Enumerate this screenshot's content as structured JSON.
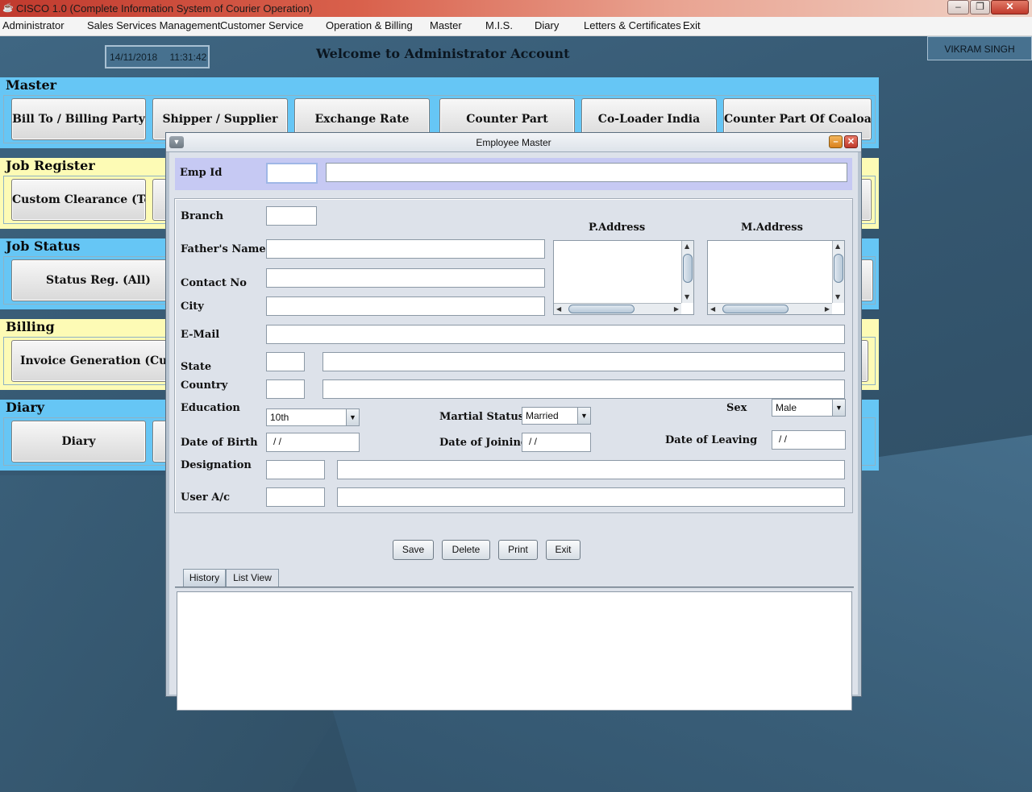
{
  "window": {
    "title": "CISCO 1.0 (Complete Information System of Courier Operation)",
    "minimize": "–",
    "maximize": "❐",
    "close": "✕"
  },
  "menu": [
    "Administrator",
    "Sales Services Management",
    "Customer Service",
    "Operation & Billing",
    "Master",
    "M.I.S.",
    "Diary",
    "Letters & Certificates",
    "Exit"
  ],
  "header": {
    "date": "14/11/2018",
    "time": "11:31:42",
    "welcome": "Welcome to Administrator Account",
    "user": "VIKRAM SINGH"
  },
  "panels": {
    "master": {
      "title": "Master",
      "buttons": [
        "Bill To / Billing Party",
        "Shipper / Supplier",
        "Exchange Rate",
        "Counter Part",
        "Co-Loader India",
        "Counter Part Of Coaloader"
      ]
    },
    "job_register": {
      "title": "Job Register",
      "buttons": [
        "Custom Clearance (Temp)"
      ]
    },
    "job_status": {
      "title": "Job Status",
      "buttons": [
        "Status Reg. (All)"
      ]
    },
    "billing": {
      "title": "Billing",
      "buttons": [
        "Invoice Generation (Custom"
      ]
    },
    "diary": {
      "title": "Diary",
      "buttons": [
        "Diary"
      ]
    }
  },
  "dialog": {
    "title": "Employee Master",
    "labels": {
      "emp_id": "Emp Id",
      "branch": "Branch",
      "p_address": "P.Address",
      "m_address": "M.Address",
      "father": "Father's Name",
      "contact": "Contact No",
      "city": "City",
      "email": "E-Mail",
      "state": "State",
      "country": "Country",
      "education": "Education",
      "marital": "Martial Status",
      "sex": "Sex",
      "dob": "Date of Birth",
      "doj": "Date of Joining",
      "dol": "Date of Leaving",
      "designation": "Designation",
      "user_ac": "User A/c"
    },
    "values": {
      "education": "10th",
      "marital": "Married",
      "sex": "Male",
      "dob": "/ /",
      "doj": "/ /",
      "dol": "/ /"
    },
    "buttons": {
      "save": "Save",
      "delete": "Delete",
      "print": "Print",
      "exit": "Exit"
    },
    "tabs": [
      "History",
      "List View"
    ]
  },
  "colors": {
    "blue_panel": "#66c6f5",
    "yellow_panel": "#fdfbb5",
    "emp_row": "#c6c9f3"
  }
}
